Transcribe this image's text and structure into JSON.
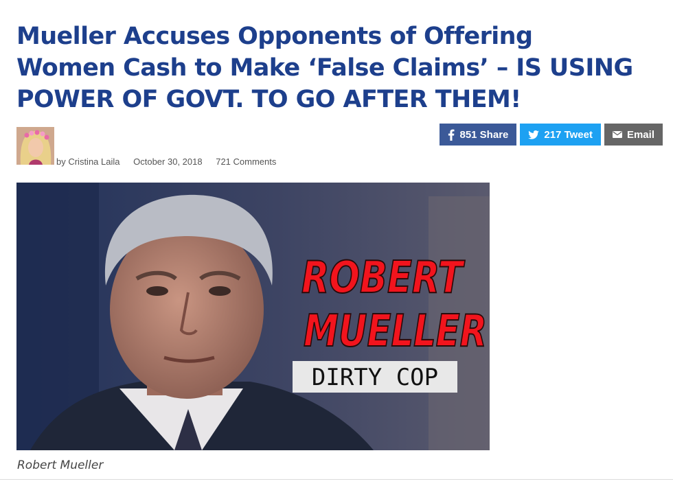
{
  "article": {
    "headline_lines": [
      "Mueller Accuses Opponents of Offering",
      "Women Cash to Make ‘False Claims’ – IS USING",
      "POWER OF GOVT. TO GO AFTER THEM!"
    ],
    "author": "by Cristina Laila",
    "date": "October 30, 2018",
    "comments": "721 Comments",
    "image_overlay": {
      "line1": "ROBERT",
      "line2": "MUELLER",
      "tag": "DIRTY COP"
    },
    "caption": "Robert Mueller"
  },
  "share": {
    "facebook": {
      "icon": "facebook-icon",
      "label": "851 Share",
      "color": "#3b5998"
    },
    "twitter": {
      "icon": "twitter-icon",
      "label": "217 Tweet",
      "color": "#1da1f2"
    },
    "email": {
      "icon": "mail-icon",
      "label": "Email",
      "color": "#666666"
    }
  }
}
